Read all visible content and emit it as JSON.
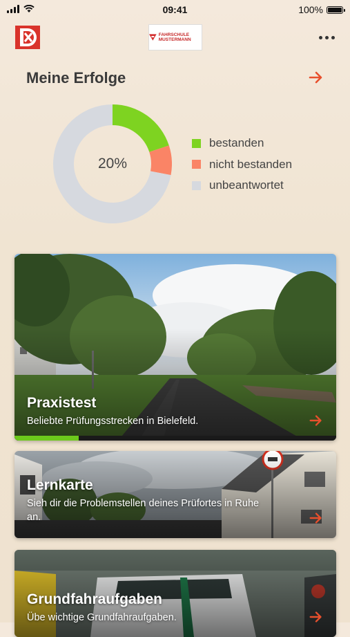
{
  "status_bar": {
    "time": "09:41",
    "battery": "100%"
  },
  "header": {
    "school_logo_text": "FAHRSCHULE MUSTERMANN"
  },
  "stats": {
    "title": "Meine Erfolge",
    "center_label": "20%",
    "chart_data": {
      "type": "pie",
      "labels": [
        "bestanden",
        "nicht bestanden",
        "unbeantwortet"
      ],
      "values": [
        20,
        8,
        72
      ],
      "colors": [
        "#7ed321",
        "#fa8466",
        "#d6d9df"
      ]
    }
  },
  "legend": [
    {
      "label": "bestanden",
      "color": "#7ed321"
    },
    {
      "label": "nicht bestanden",
      "color": "#fa8466"
    },
    {
      "label": "unbeantwortet",
      "color": "#d6d9df"
    }
  ],
  "cards": [
    {
      "title": "Praxistest",
      "subtitle": "Beliebte Prüfungsstrecken in Bielefeld.",
      "progress": 0.2
    },
    {
      "title": "Lernkarte",
      "subtitle": "Sieh dir die Problemstellen deines Prüfortes in Ruhe an."
    },
    {
      "title": "Grundfahraufgaben",
      "subtitle": "Übe wichtige Grundfahraufgaben."
    }
  ],
  "colors": {
    "accent": "#e8502d",
    "green": "#7ed321"
  },
  "icons": {
    "app_logo": "app-logo-icon",
    "arrow": "arrow-right-icon",
    "more": "more-icon"
  }
}
